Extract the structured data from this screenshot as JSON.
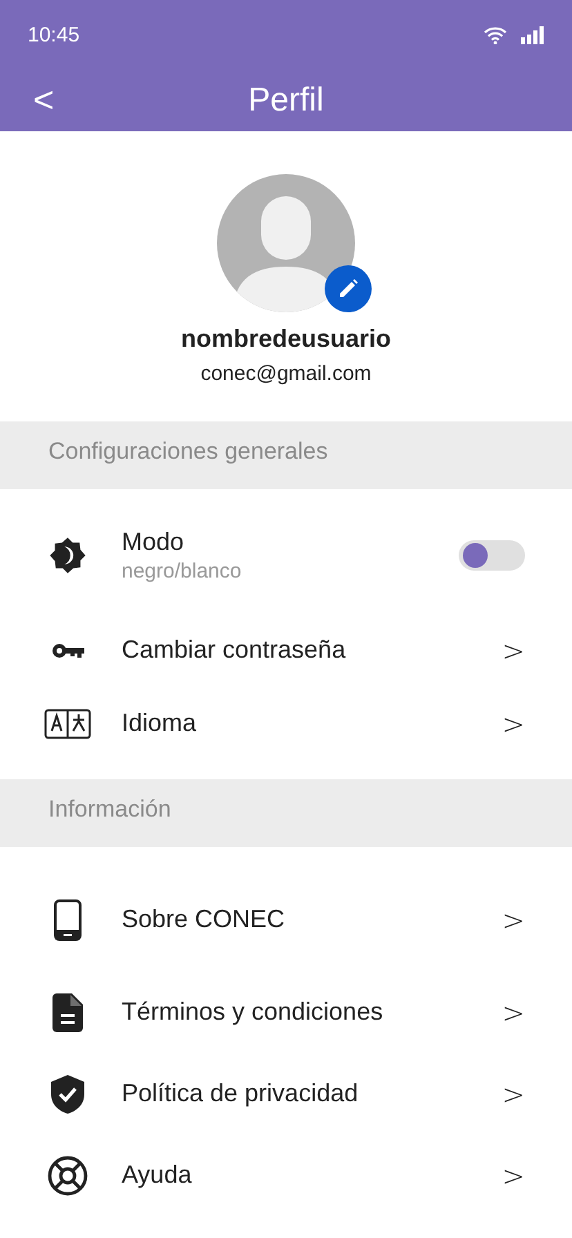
{
  "status_bar": {
    "time": "10:45"
  },
  "header": {
    "back": "<",
    "title": "Perfil"
  },
  "profile": {
    "username": "nombredeusuario",
    "email": "conec@gmail.com"
  },
  "sections": [
    {
      "title": "Configuraciones generales",
      "items": [
        {
          "kind": "toggle",
          "label": "Modo",
          "sublabel": "negro/blanco",
          "on": false
        },
        {
          "kind": "link",
          "label": "Cambiar contraseña",
          "chevron": ">"
        },
        {
          "kind": "link",
          "label": "Idioma",
          "chevron": ">"
        }
      ]
    },
    {
      "title": "Información",
      "items": [
        {
          "kind": "link",
          "label": "Sobre CONEC",
          "chevron": ">"
        },
        {
          "kind": "link",
          "label": "Términos y condiciones",
          "chevron": ">"
        },
        {
          "kind": "link",
          "label": "Política de privacidad",
          "chevron": ">"
        },
        {
          "kind": "link",
          "label": "Ayuda",
          "chevron": ">"
        }
      ]
    }
  ]
}
